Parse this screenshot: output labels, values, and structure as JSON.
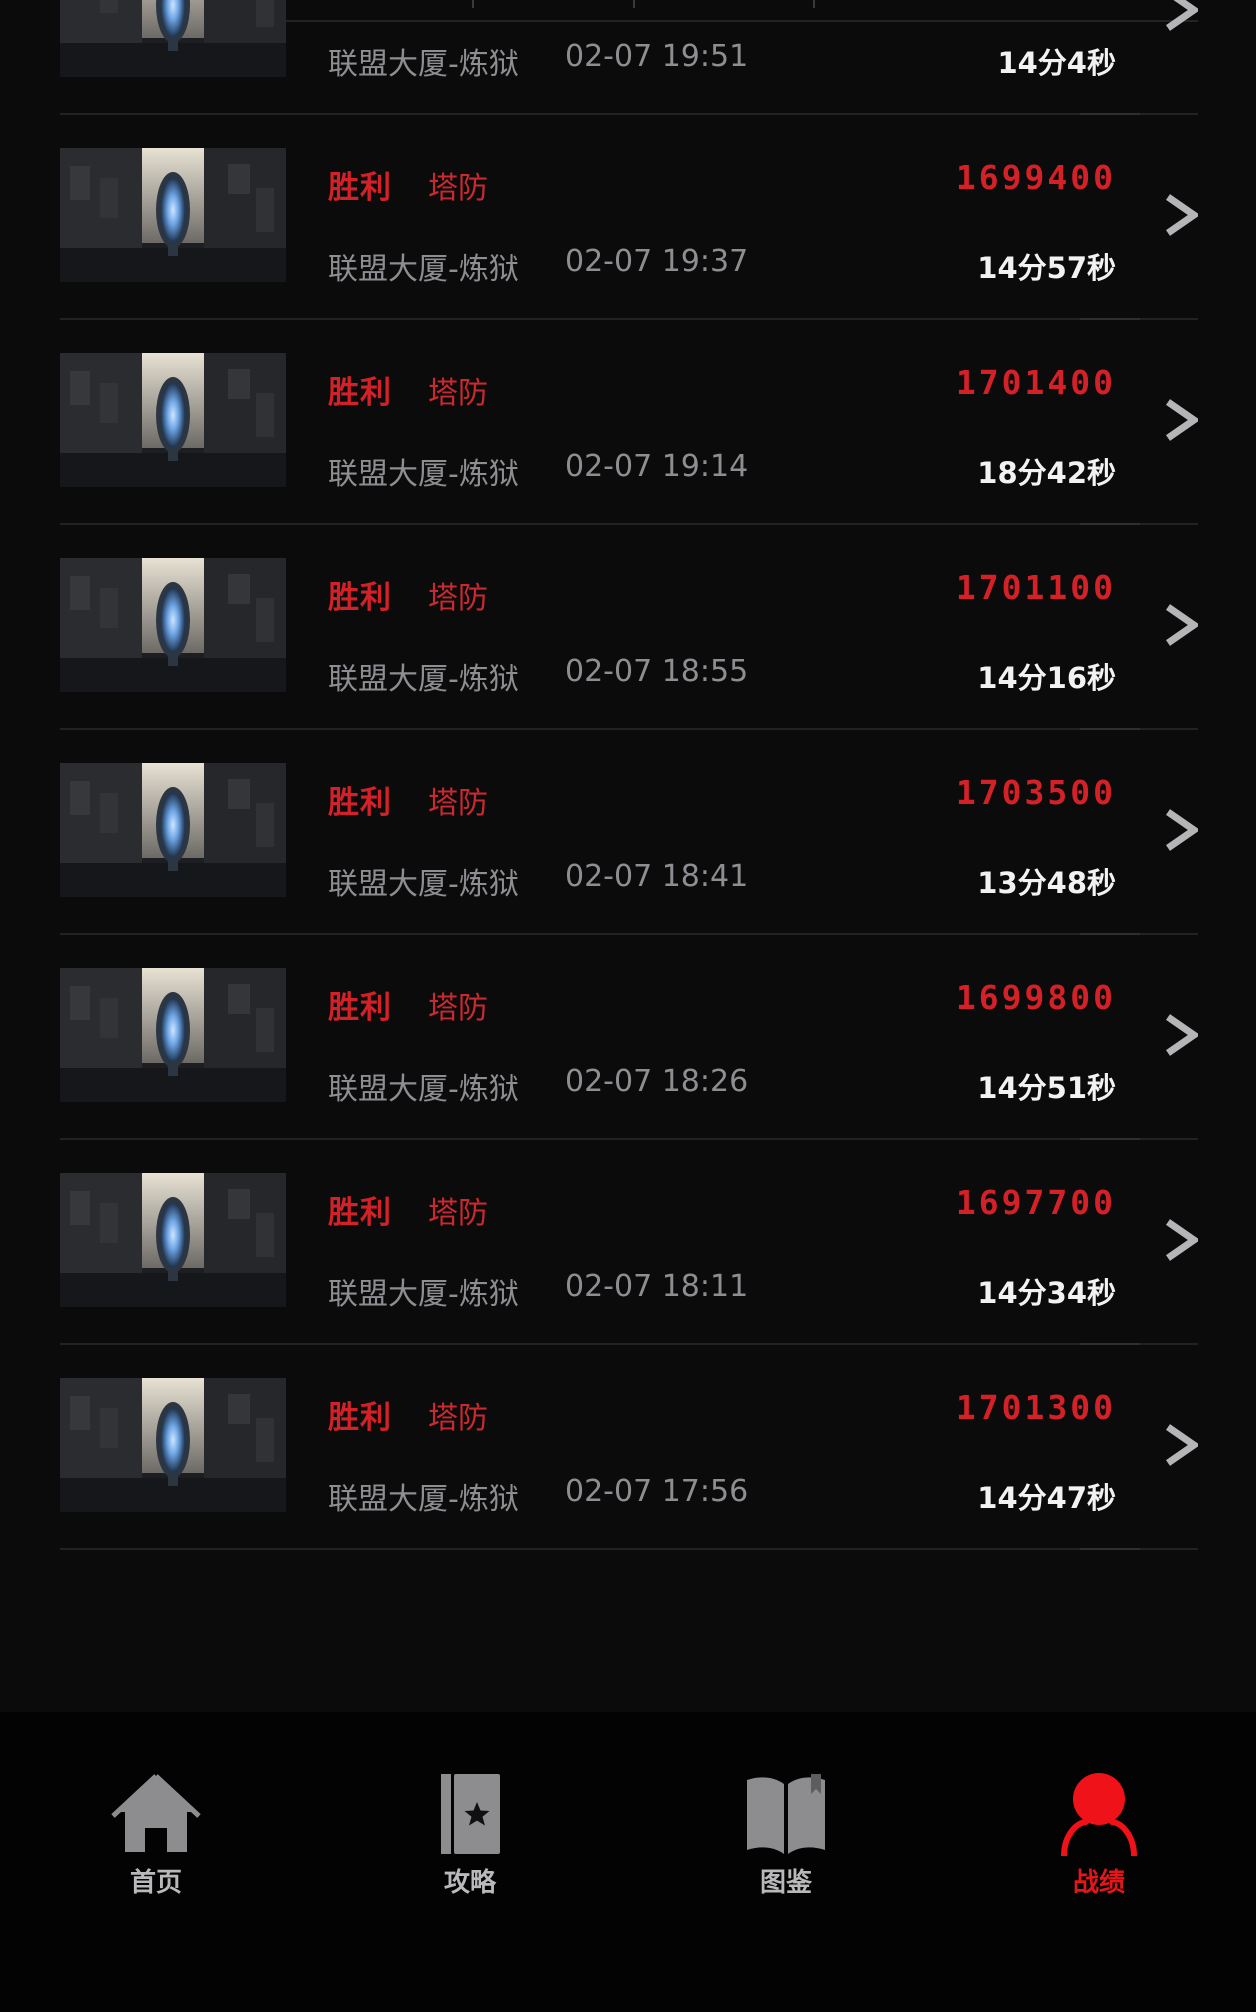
{
  "records": [
    {
      "result": "",
      "mode": "",
      "score": "",
      "map": "联盟大厦-炼狱",
      "time": "02-07 19:51",
      "duration": "14分4秒"
    },
    {
      "result": "胜利",
      "mode": "塔防",
      "score": "1699400",
      "map": "联盟大厦-炼狱",
      "time": "02-07 19:37",
      "duration": "14分57秒"
    },
    {
      "result": "胜利",
      "mode": "塔防",
      "score": "1701400",
      "map": "联盟大厦-炼狱",
      "time": "02-07 19:14",
      "duration": "18分42秒"
    },
    {
      "result": "胜利",
      "mode": "塔防",
      "score": "1701100",
      "map": "联盟大厦-炼狱",
      "time": "02-07 18:55",
      "duration": "14分16秒"
    },
    {
      "result": "胜利",
      "mode": "塔防",
      "score": "1703500",
      "map": "联盟大厦-炼狱",
      "time": "02-07 18:41",
      "duration": "13分48秒"
    },
    {
      "result": "胜利",
      "mode": "塔防",
      "score": "1699800",
      "map": "联盟大厦-炼狱",
      "time": "02-07 18:26",
      "duration": "14分51秒"
    },
    {
      "result": "胜利",
      "mode": "塔防",
      "score": "1697700",
      "map": "联盟大厦-炼狱",
      "time": "02-07 18:11",
      "duration": "14分34秒"
    },
    {
      "result": "胜利",
      "mode": "塔防",
      "score": "1701300",
      "map": "联盟大厦-炼狱",
      "time": "02-07 17:56",
      "duration": "14分47秒"
    }
  ],
  "nav": {
    "items": [
      {
        "label": "首页",
        "icon": "home-icon",
        "active": false
      },
      {
        "label": "攻略",
        "icon": "guide-book-star-icon",
        "active": false
      },
      {
        "label": "图鉴",
        "icon": "open-book-icon",
        "active": false
      },
      {
        "label": "战绩",
        "icon": "user-icon",
        "active": true
      }
    ]
  },
  "colors": {
    "background": "#0b0b0c",
    "accent_red": "#d42128",
    "muted_text": "#8e8e92",
    "bright_text": "#f2f2f2",
    "nav_background": "#030303",
    "nav_inactive": "#b9b9bb"
  }
}
